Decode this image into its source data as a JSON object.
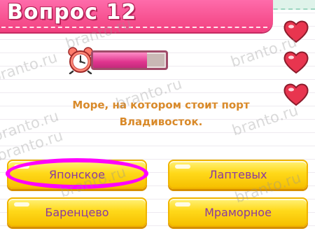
{
  "header": {
    "title": "Вопрос 12"
  },
  "timer": {
    "level": 0.74,
    "fill_color": "#e0358f"
  },
  "lives": {
    "count": 3,
    "icon": "heart-icon",
    "color": "#e8354f"
  },
  "question": {
    "line1": "Море, на котором стоит порт",
    "line2": "Владивосток."
  },
  "answers": [
    {
      "label": "Японское",
      "selected": true
    },
    {
      "label": "Лаптевых",
      "selected": false
    },
    {
      "label": "Баренцево",
      "selected": false
    },
    {
      "label": "Мраморное",
      "selected": false
    }
  ],
  "colors": {
    "header_pink": "#f2407f",
    "question_text": "#d98a2a",
    "answer_text": "#8a3aa0",
    "answer_yellow": "#ffd91a",
    "highlight": "#ff00ff"
  },
  "watermark": "branto.ru"
}
